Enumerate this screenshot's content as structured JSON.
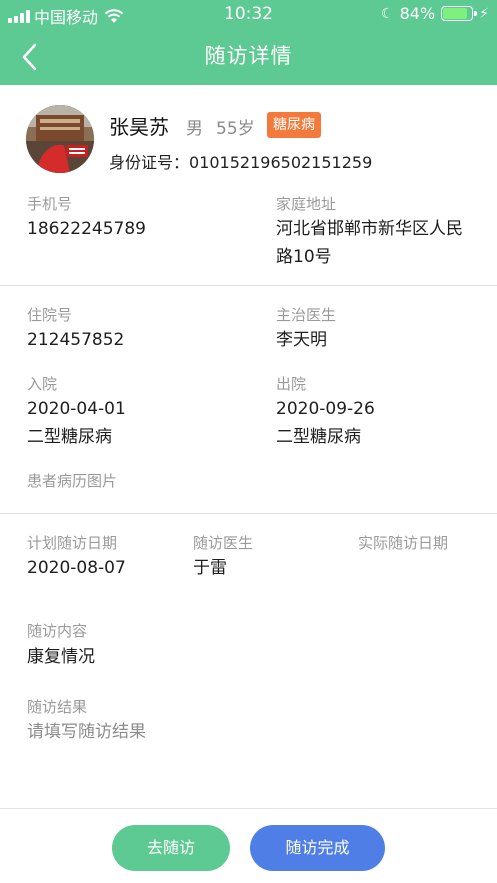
{
  "status_bar": {
    "carrier": "中国移动",
    "time": "10:32",
    "battery": "84%",
    "battery_level": 0.84,
    "icons": [
      "signal-icon",
      "wifi-icon",
      "moon-icon",
      "battery-icon",
      "charging-icon"
    ]
  },
  "nav": {
    "title": "随访详情",
    "back_icon": "chevron-left-icon"
  },
  "patient": {
    "name": "张昊苏",
    "gender": "男",
    "age": "55岁",
    "tag": "糖尿病",
    "id_label": "身份证号：",
    "id_value": "010152196502151259"
  },
  "contact": {
    "phone_label": "手机号",
    "phone": "18622245789",
    "address_label": "家庭地址",
    "address": "河北省邯郸市新华区人民路10号"
  },
  "hospital": {
    "inpatient_no_label": "住院号",
    "inpatient_no": "212457852",
    "doctor_label": "主治医生",
    "doctor": "李天明",
    "admit_label": "入院",
    "admit_date": "2020-04-01",
    "admit_diag": "二型糖尿病",
    "discharge_label": "出院",
    "discharge_date": "2020-09-26",
    "discharge_diag": "二型糖尿病",
    "images_label": "患者病历图片"
  },
  "followup": {
    "plan_date_label": "计划随访日期",
    "plan_date": "2020-08-07",
    "doctor_label": "随访医生",
    "doctor": "于雷",
    "actual_date_label": "实际随访日期",
    "actual_date": "",
    "content_label": "随访内容",
    "content": "康复情况",
    "result_label": "随访结果",
    "result_placeholder": "请填写随访结果"
  },
  "actions": {
    "go_label": "去随访",
    "done_label": "随访完成"
  },
  "colors": {
    "primary_green": "#5dc993",
    "tag_orange": "#f37a3a",
    "button_blue": "#4f7fe6",
    "label_gray": "#9a9a9a"
  }
}
